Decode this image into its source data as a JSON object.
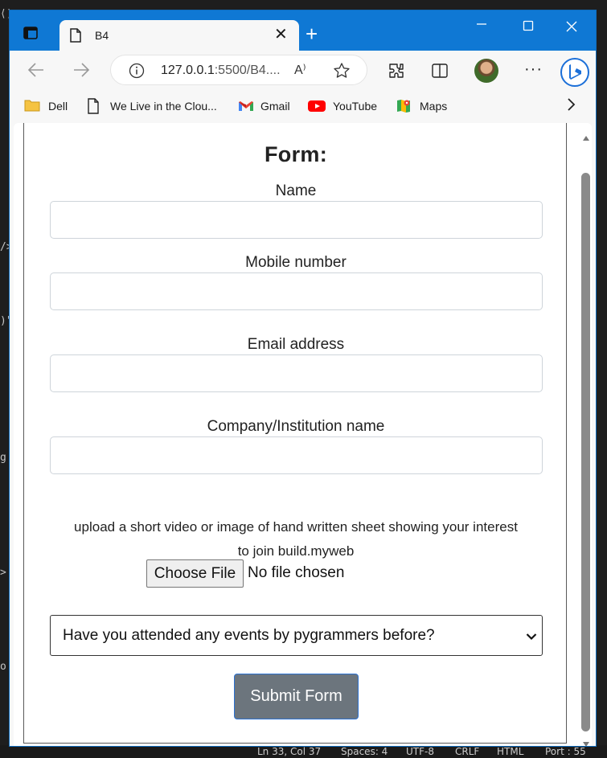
{
  "browser": {
    "tab_title": "B4",
    "url_host": "127.0.0.1",
    "url_rest": ":5500/B4....",
    "read_aloud_glyph": "A⁾",
    "colors": {
      "titlebar": "#0f78d4",
      "submit": "#6c757d"
    },
    "bookmarks": [
      {
        "label": "Dell",
        "icon": "folder-icon"
      },
      {
        "label": "We Live in the Clou...",
        "icon": "page-icon"
      },
      {
        "label": "Gmail",
        "icon": "gmail-icon"
      },
      {
        "label": "YouTube",
        "icon": "youtube-icon"
      },
      {
        "label": "Maps",
        "icon": "maps-icon"
      }
    ]
  },
  "form": {
    "title": "Form:",
    "fields": {
      "name": "Name",
      "mobile": "Mobile number",
      "email": "Email address",
      "company": "Company/Institution name"
    },
    "upload_text": "upload a short video or image of hand written sheet showing your interest to join build.myweb",
    "choose_file_label": "Choose File",
    "file_status": "No file chosen",
    "events_select_value": "Have you attended any events by pygrammers before?",
    "submit_label": "Submit Form"
  },
  "editor_statusbar": {
    "position": "Ln 33, Col 37",
    "spaces": "Spaces: 4",
    "encoding": "UTF-8",
    "eol": "CRLF",
    "language": "HTML",
    "port": "Port : 55"
  }
}
